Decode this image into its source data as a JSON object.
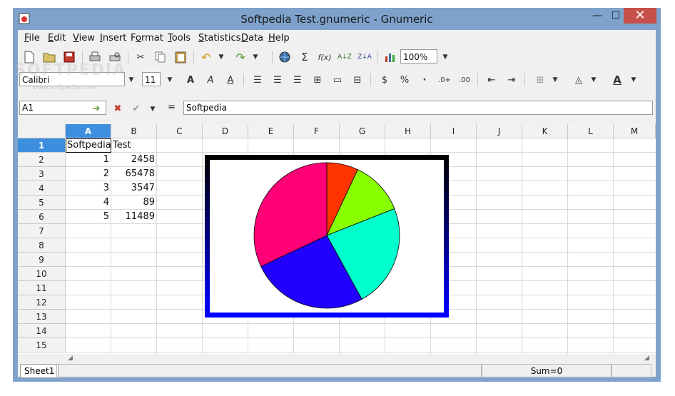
{
  "window": {
    "title": "Softpedia Test.gnumeric - Gnumeric"
  },
  "menu": [
    "File",
    "Edit",
    "View",
    "Insert",
    "Format",
    "Tools",
    "Statistics",
    "Data",
    "Help"
  ],
  "menu_underline": [
    "F",
    "E",
    "V",
    "I",
    "o",
    "T",
    "S",
    "D",
    "H"
  ],
  "zoom": "100%",
  "font": {
    "name": "Calibri",
    "size": "11"
  },
  "formula": {
    "cell_ref": "A1",
    "equals": "=",
    "content": "Softpedia"
  },
  "sheet": {
    "columns": [
      "A",
      "B",
      "C",
      "D",
      "E",
      "F",
      "G",
      "H",
      "I",
      "J",
      "K",
      "L",
      "M"
    ],
    "rows": [
      "1",
      "2",
      "3",
      "4",
      "5",
      "6",
      "7",
      "8",
      "9",
      "10",
      "11",
      "12",
      "13",
      "14",
      "15"
    ],
    "selected_column": "A",
    "selected_row": "1",
    "cells": {
      "A1": "Softpedia",
      "B1": "Test",
      "A2": "1",
      "B2": "2458",
      "A3": "2",
      "B3": "65478",
      "A4": "3",
      "B4": "3547",
      "A5": "4",
      "B5": "89",
      "A6": "5",
      "B6": "11489"
    }
  },
  "chart_data": {
    "type": "pie",
    "values": [
      2458,
      3547,
      89,
      11489,
      65478
    ],
    "slice_colors_in_image": [
      "#ff3300",
      "#88ff00",
      "#00ffcc",
      "#2200ff",
      "#ff0077"
    ],
    "rendered_slices_approx_percent": [
      7,
      12,
      23,
      26,
      32
    ],
    "title": ""
  },
  "status": {
    "sheet_tab": "Sheet1",
    "sum": "Sum=0"
  },
  "watermark": {
    "big": "SOFTPEDIA",
    "small": "www.softpedia.com"
  },
  "colors": {
    "titlebar": "#7ea2cc",
    "selection": "#3d8ede",
    "close": "#c7504a"
  }
}
